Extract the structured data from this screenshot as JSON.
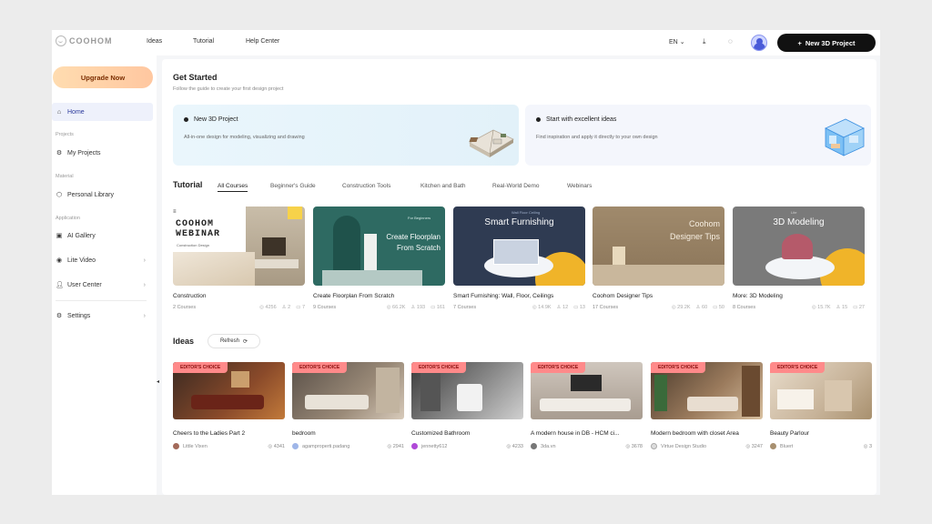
{
  "header": {
    "logo_text": "COOHOM",
    "nav": [
      "Ideas",
      "Tutorial",
      "Help Center"
    ],
    "language": "EN",
    "new_project_label": "New 3D Project"
  },
  "sidebar": {
    "upgrade_label": "Upgrade Now",
    "home": "Home",
    "sections": {
      "projects": "Projects",
      "material": "Material",
      "application": "Application"
    },
    "items": {
      "my_projects": "My Projects",
      "personal_library": "Personal Library",
      "ai_gallery": "AI Gallery",
      "lite_video": "Lite Video",
      "user_center": "User Center",
      "settings": "Settings"
    }
  },
  "get_started": {
    "title": "Get Started",
    "subtitle": "Follow the guide to create your first design project",
    "cards": [
      {
        "title": "New 3D Project",
        "desc": "All-in-one design for modeling, visualizing and drawing"
      },
      {
        "title": "Start with excellent ideas",
        "desc": "Find inspiration and apply it directly to your own design"
      }
    ]
  },
  "tutorial": {
    "title": "Tutorial",
    "tabs": [
      "All Courses",
      "Beginner's Guide",
      "Construction Tools",
      "Kitchen and Bath",
      "Real-World Demo",
      "Webinars"
    ],
    "courses": [
      {
        "name": "Construction",
        "count": "2 Courses",
        "views": "4256",
        "likes": "2",
        "saves": "7",
        "thumb_line1": "COOHOM",
        "thumb_line2": "WEBINAR",
        "thumb_sub": "Construction Design"
      },
      {
        "name": "Create Floorplan From Scratch",
        "count": "9 Courses",
        "views": "66.2K",
        "likes": "193",
        "saves": "161",
        "thumb_tag": "For Beginners",
        "thumb_line1": "Create Floorplan",
        "thumb_line2": "From Scratch"
      },
      {
        "name": "Smart Furnishing: Wall, Floor, Ceilings",
        "count": "7 Courses",
        "views": "14.9K",
        "likes": "12",
        "saves": "13",
        "thumb_tag": "Wall Floor Ceiling",
        "thumb_line1": "Smart Furnishing"
      },
      {
        "name": "Coohom Designer Tips",
        "count": "17 Courses",
        "views": "29.2K",
        "likes": "60",
        "saves": "50",
        "thumb_line1": "Coohom",
        "thumb_line2": "Designer Tips"
      },
      {
        "name": "More: 3D Modeling",
        "count": "8 Courses",
        "views": "15.7K",
        "likes": "15",
        "saves": "27",
        "thumb_tag": "Lite",
        "thumb_line1": "3D Modeling"
      }
    ]
  },
  "ideas": {
    "title": "Ideas",
    "refresh_label": "Refresh",
    "badge": "EDITOR'S CHOICE",
    "items": [
      {
        "name": "Cheers to the Ladies Part 2",
        "author": "Little Vixen",
        "views": "4341"
      },
      {
        "name": "bedroom",
        "author": "agamproperti.padang",
        "views": "2941"
      },
      {
        "name": "Customized Bathroom",
        "author": "jennetty612",
        "views": "4233"
      },
      {
        "name": "A modern house in DB - HCM ci...",
        "author": "3da.vn",
        "views": "3678"
      },
      {
        "name": "Modern bedroom with closet Area",
        "author": "Virtue Design Studio",
        "views": "3247"
      },
      {
        "name": "Beauty Parlour",
        "author": "Bluert",
        "views": "3"
      }
    ]
  },
  "colors": {
    "accent": "#2b3a9c",
    "primary_button": "#111111",
    "upgrade_gradient_start": "#ffdcb0",
    "badge_bg": "#ff8a8a"
  }
}
